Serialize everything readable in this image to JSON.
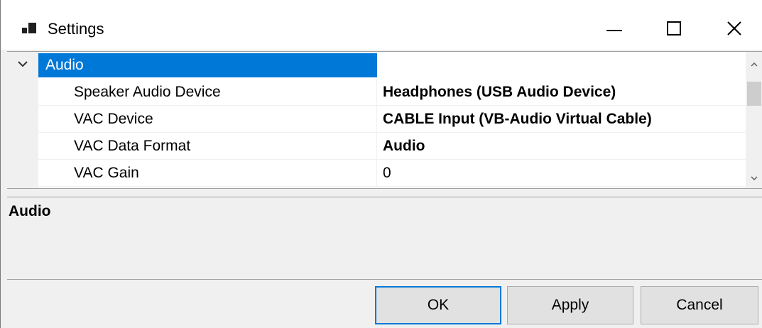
{
  "window": {
    "title": "Settings",
    "icon": "app-window-icon",
    "controls": {
      "minimize": "minimize-icon",
      "maximize": "maximize-icon",
      "close": "close-icon"
    }
  },
  "grid": {
    "category": {
      "label": "Audio",
      "expanded": true,
      "icon": "chevron-down-icon"
    },
    "rows": [
      {
        "name": "Speaker Audio Device",
        "value": "Headphones (USB Audio Device)",
        "bold": true
      },
      {
        "name": "VAC Device",
        "value": "CABLE Input (VB-Audio Virtual Cable)",
        "bold": true
      },
      {
        "name": "VAC Data Format",
        "value": "Audio",
        "bold": true
      },
      {
        "name": "VAC Gain",
        "value": "0",
        "bold": false
      }
    ]
  },
  "description": {
    "title": "Audio"
  },
  "buttons": {
    "ok": "OK",
    "apply": "Apply",
    "cancel": "Cancel"
  },
  "colors": {
    "selection": "#0078d7",
    "background": "#f0f0f0"
  }
}
